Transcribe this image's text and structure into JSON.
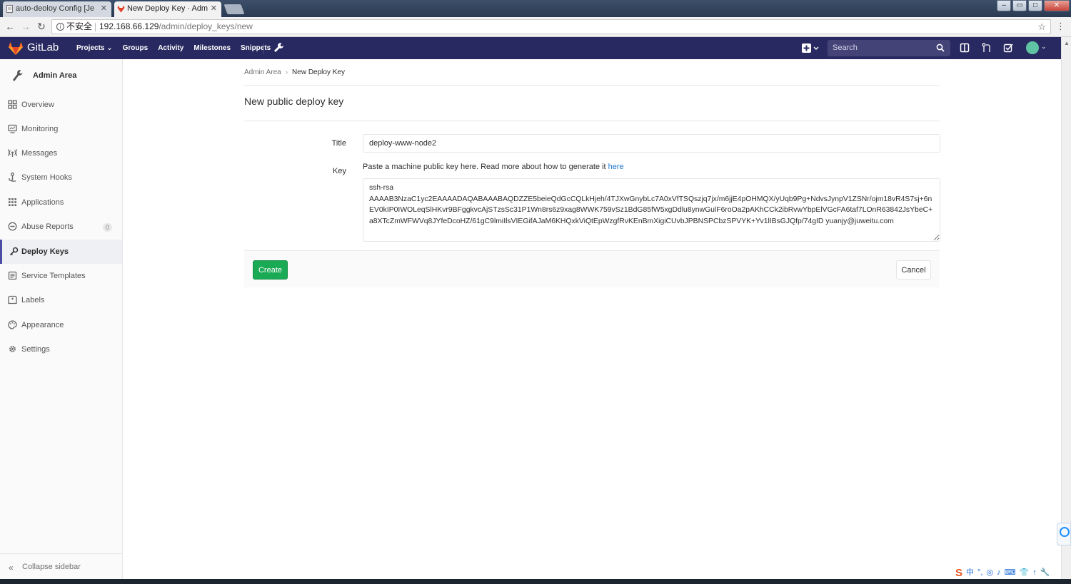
{
  "browser": {
    "tabs": [
      {
        "label": "auto-deoloy Config [Je",
        "active": false
      },
      {
        "label": "New Deploy Key · Adm",
        "active": true
      }
    ],
    "security_label": "不安全",
    "url_host": "192.168.66.129",
    "url_path": "/admin/deploy_keys/new"
  },
  "header": {
    "brand": "GitLab",
    "nav": [
      "Projects",
      "Groups",
      "Activity",
      "Milestones",
      "Snippets"
    ],
    "search_placeholder": "Search",
    "colors": {
      "header_bg": "#292961",
      "accent": "#fc6d26",
      "primary": "#1aaa55"
    }
  },
  "sidebar": {
    "title": "Admin Area",
    "items": [
      {
        "label": "Overview",
        "icon": "overview-icon"
      },
      {
        "label": "Monitoring",
        "icon": "monitor-icon"
      },
      {
        "label": "Messages",
        "icon": "broadcast-icon"
      },
      {
        "label": "System Hooks",
        "icon": "hook-icon"
      },
      {
        "label": "Applications",
        "icon": "grid-icon"
      },
      {
        "label": "Abuse Reports",
        "icon": "abuse-icon",
        "badge": "0"
      },
      {
        "label": "Deploy Keys",
        "icon": "key-icon",
        "active": true
      },
      {
        "label": "Service Templates",
        "icon": "template-icon"
      },
      {
        "label": "Labels",
        "icon": "label-icon"
      },
      {
        "label": "Appearance",
        "icon": "palette-icon"
      },
      {
        "label": "Settings",
        "icon": "gear-icon"
      }
    ],
    "collapse_label": "Collapse sidebar"
  },
  "main": {
    "breadcrumb": {
      "root": "Admin Area",
      "current": "New Deploy Key"
    },
    "title": "New public deploy key",
    "form": {
      "title_label": "Title",
      "title_value": "deploy-www-node2",
      "key_label": "Key",
      "key_help": "Paste a machine public key here. Read more about how to generate it ",
      "key_help_link": "here",
      "key_value": "ssh-rsa\nAAAAB3NzaC1yc2EAAAADAQABAAABAQDZZE5beieQdGcCQLkHjeh/4TJXwGnybLc7A0xVfTSQszjq7jx/m6jjE4pOHMQX/yUqb9Pg+NdvsJynpV1ZSNr/ojm18vR4S7sj+6nEV0kIP0IWOLeqSlHKvr9BFggkvcAjSTzsSc31P1Wn8rs6z9xag8WWK759vSz1BdG85fW5xgDdlu8ynwGulF6roOa2pAKhCCk2ibRvwYbpElVGcFA6taf7LOnR63842JsYbeC+a8XTcZmWFWVq8JYfeDcoHZ/61gC9lmiIlsVIEGifAJaM6KHQxkViQtEpWzgfRvKEnBmXigiCUvbJPBNSPCbzSPVYK+Yv1lIBsGJQfp/74gID yuanjy@juweitu.com",
      "create_label": "Create",
      "cancel_label": "Cancel"
    }
  },
  "tray": [
    "S",
    "中",
    "°,",
    "◎",
    "♪",
    "⌨",
    "👕",
    "↑",
    "🔧"
  ]
}
